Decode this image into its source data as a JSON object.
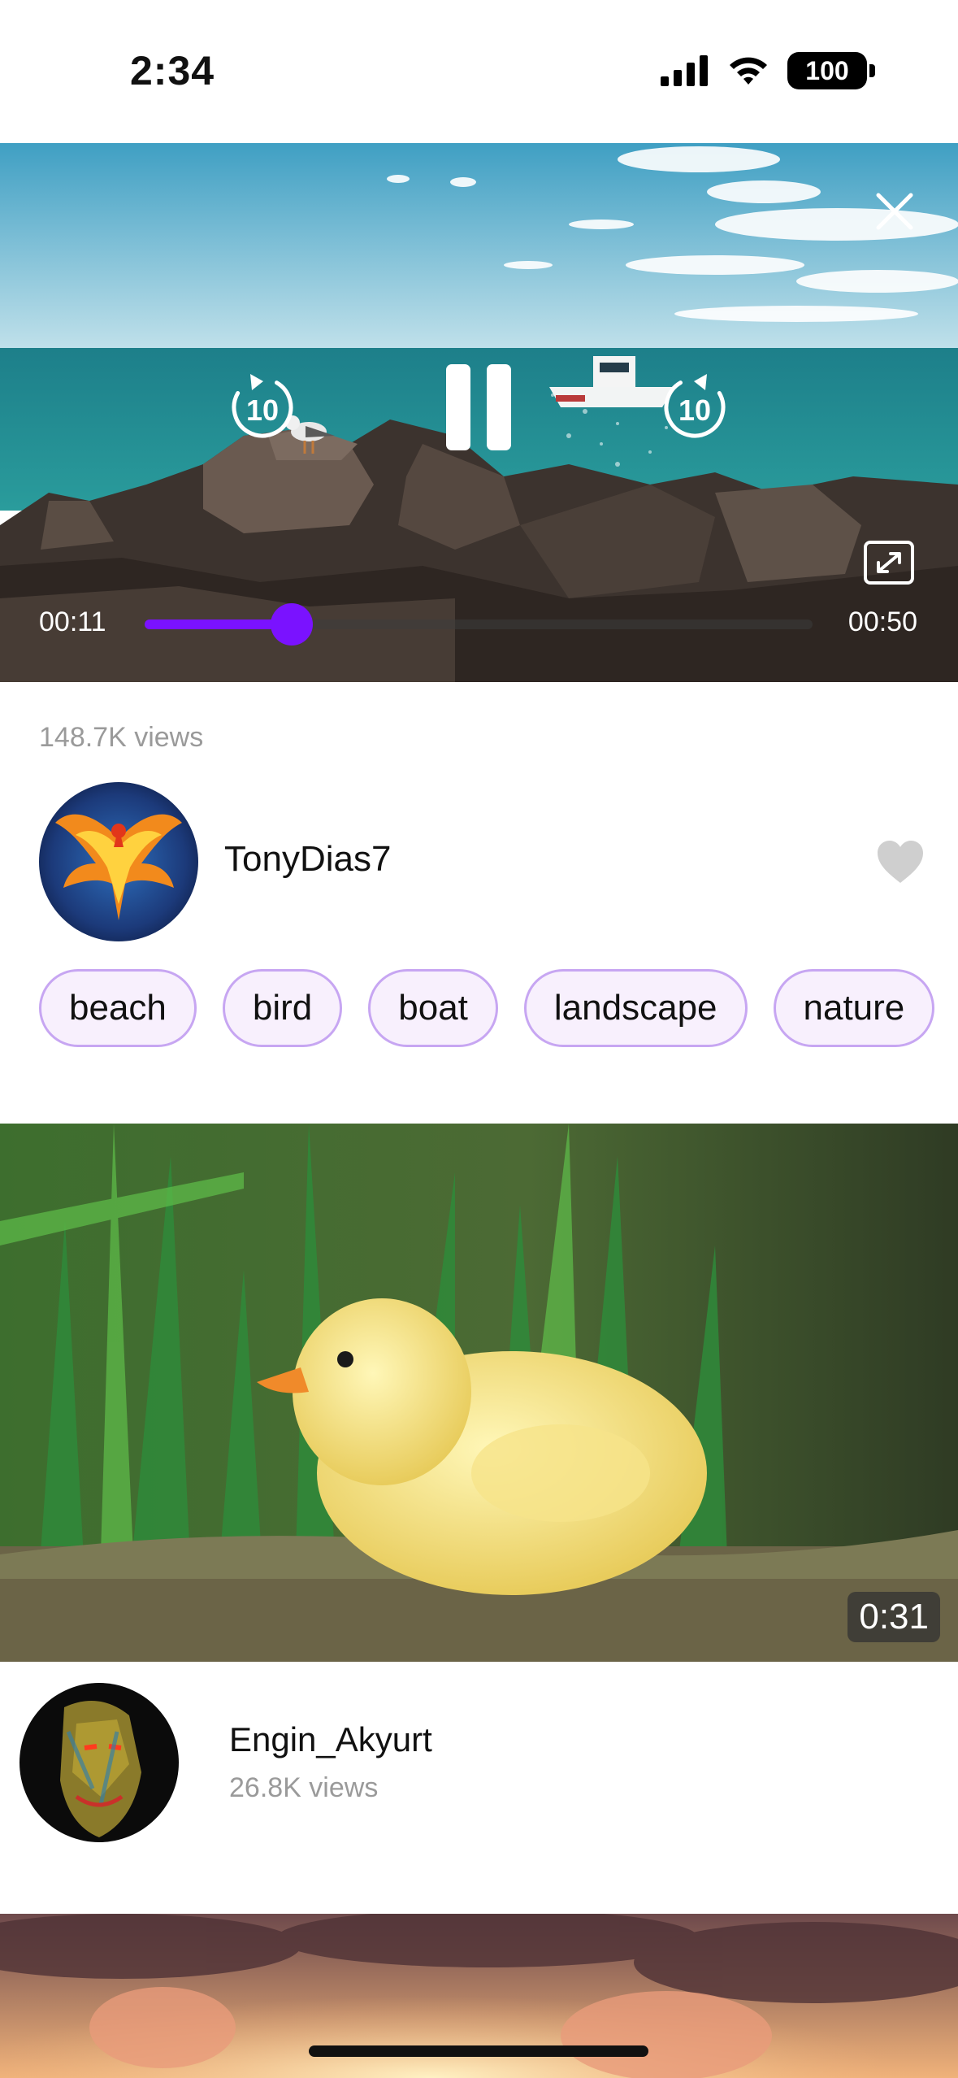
{
  "status_bar": {
    "time": "2:34",
    "battery": "100"
  },
  "player": {
    "current_time": "00:11",
    "total_time": "00:50",
    "progress": 0.22,
    "rewind_seconds": "10",
    "forward_seconds": "10",
    "accent_color": "#7a12ff"
  },
  "video": {
    "views": "148.7K views",
    "author": "TonyDias7",
    "tags": [
      "beach",
      "bird",
      "boat",
      "landscape",
      "nature"
    ],
    "tag_border_color": "#c7a6f2",
    "tag_background_color": "#f8f0fd"
  },
  "feed": [
    {
      "author": "Engin_Akyurt",
      "views": "26.8K views",
      "duration": "0:31"
    }
  ],
  "icons": [
    "signal-icon",
    "wifi-icon",
    "battery-icon",
    "close-icon",
    "rewind-icon",
    "pause-icon",
    "forward-icon",
    "expand-icon",
    "heart-icon"
  ]
}
